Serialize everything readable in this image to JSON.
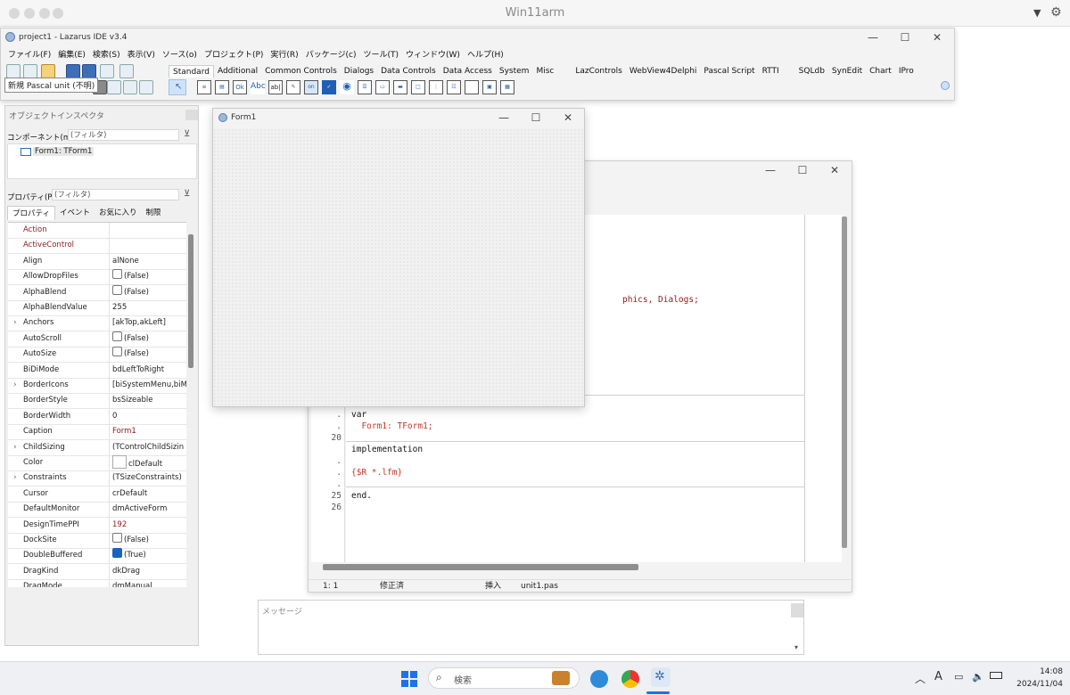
{
  "host": {
    "title": "Win11arm"
  },
  "ide": {
    "title": "project1 - Lazarus IDE v3.4",
    "menu": [
      "ファイル(F)",
      "編集(E)",
      "検索(S)",
      "表示(V)",
      "ソース(o)",
      "プロジェクト(P)",
      "実行(R)",
      "パッケージ(c)",
      "ツール(T)",
      "ウィンドウ(W)",
      "ヘルプ(H)"
    ],
    "tooltip": "新規 Pascal unit (不明)",
    "palette_tabs": [
      "Standard",
      "Additional",
      "Common Controls",
      "Dialogs",
      "Data Controls",
      "Data Access",
      "System",
      "Misc",
      "LazControls",
      "WebView4Delphi",
      "Pascal Script",
      "RTTI",
      "SQLdb",
      "SynEdit",
      "Chart",
      "IPro"
    ],
    "palette_glyphs": [
      "Ok",
      "Abc",
      "ab|",
      "on"
    ]
  },
  "inspector": {
    "title": "オブジェクトインスペクタ",
    "component_label": "コンポーネント(m)",
    "filter_placeholder": "(フィルタ)",
    "tree_item": "Form1: TForm1",
    "property_label": "プロパティ(P)",
    "tabs": [
      "プロパティ",
      "イベント",
      "お気に入り",
      "制限"
    ],
    "rows": [
      {
        "name": "Action",
        "value": "",
        "red": true
      },
      {
        "name": "ActiveControl",
        "value": "",
        "red": true
      },
      {
        "name": "Align",
        "value": "alNone"
      },
      {
        "name": "AllowDropFiles",
        "value": "(False)",
        "check": "off"
      },
      {
        "name": "AlphaBlend",
        "value": "(False)",
        "check": "off"
      },
      {
        "name": "AlphaBlendValue",
        "value": "255"
      },
      {
        "name": "Anchors",
        "value": "[akTop,akLeft]",
        "expand": true
      },
      {
        "name": "AutoScroll",
        "value": "(False)",
        "check": "off"
      },
      {
        "name": "AutoSize",
        "value": "(False)",
        "check": "off"
      },
      {
        "name": "BiDiMode",
        "value": "bdLeftToRight"
      },
      {
        "name": "BorderIcons",
        "value": "[biSystemMenu,biM",
        "expand": true
      },
      {
        "name": "BorderStyle",
        "value": "bsSizeable"
      },
      {
        "name": "BorderWidth",
        "value": "0"
      },
      {
        "name": "Caption",
        "value": "Form1",
        "redval": true
      },
      {
        "name": "ChildSizing",
        "value": "(TControlChildSizin",
        "expand": true
      },
      {
        "name": "Color",
        "value": "clDefault",
        "swatch": true
      },
      {
        "name": "Constraints",
        "value": "(TSizeConstraints)",
        "expand": true
      },
      {
        "name": "Cursor",
        "value": "crDefault"
      },
      {
        "name": "DefaultMonitor",
        "value": "dmActiveForm"
      },
      {
        "name": "DesignTimePPI",
        "value": "192",
        "redval": true
      },
      {
        "name": "DockSite",
        "value": "(False)",
        "check": "off"
      },
      {
        "name": "DoubleBuffered",
        "value": "(True)",
        "check": "on"
      },
      {
        "name": "DragKind",
        "value": "dkDrag"
      },
      {
        "name": "DragMode",
        "value": "dmManual"
      }
    ]
  },
  "form1": {
    "title": "Form1"
  },
  "editor": {
    "partial_line": "phics, Dialogs;",
    "lines": [
      {
        "num": ".",
        "code": "var",
        "kw": true
      },
      {
        "num": ".",
        "code": "  Form1: TForm1;",
        "red": true
      },
      {
        "num": "20",
        "code": ""
      },
      {
        "num": "",
        "code": "implementation",
        "kw": true
      },
      {
        "num": ".",
        "code": ""
      },
      {
        "num": ".",
        "code": "{$R *.lfm}",
        "red": true
      },
      {
        "num": ".",
        "code": ""
      },
      {
        "num": "25",
        "code": "end.",
        "kw": true
      },
      {
        "num": "26",
        "code": ""
      }
    ],
    "status": {
      "pos": "1:  1",
      "modified": "修正済",
      "mode": "挿入",
      "file": "unit1.pas"
    }
  },
  "messages": {
    "title": "メッセージ"
  },
  "taskbar": {
    "search": "検索",
    "time": "14:08",
    "date": "2024/11/04",
    "ime": "A"
  },
  "colors": {
    "accent": "#1565c0",
    "red_text": "#8b1a1a",
    "grid_dot": "#cfcfcf"
  }
}
